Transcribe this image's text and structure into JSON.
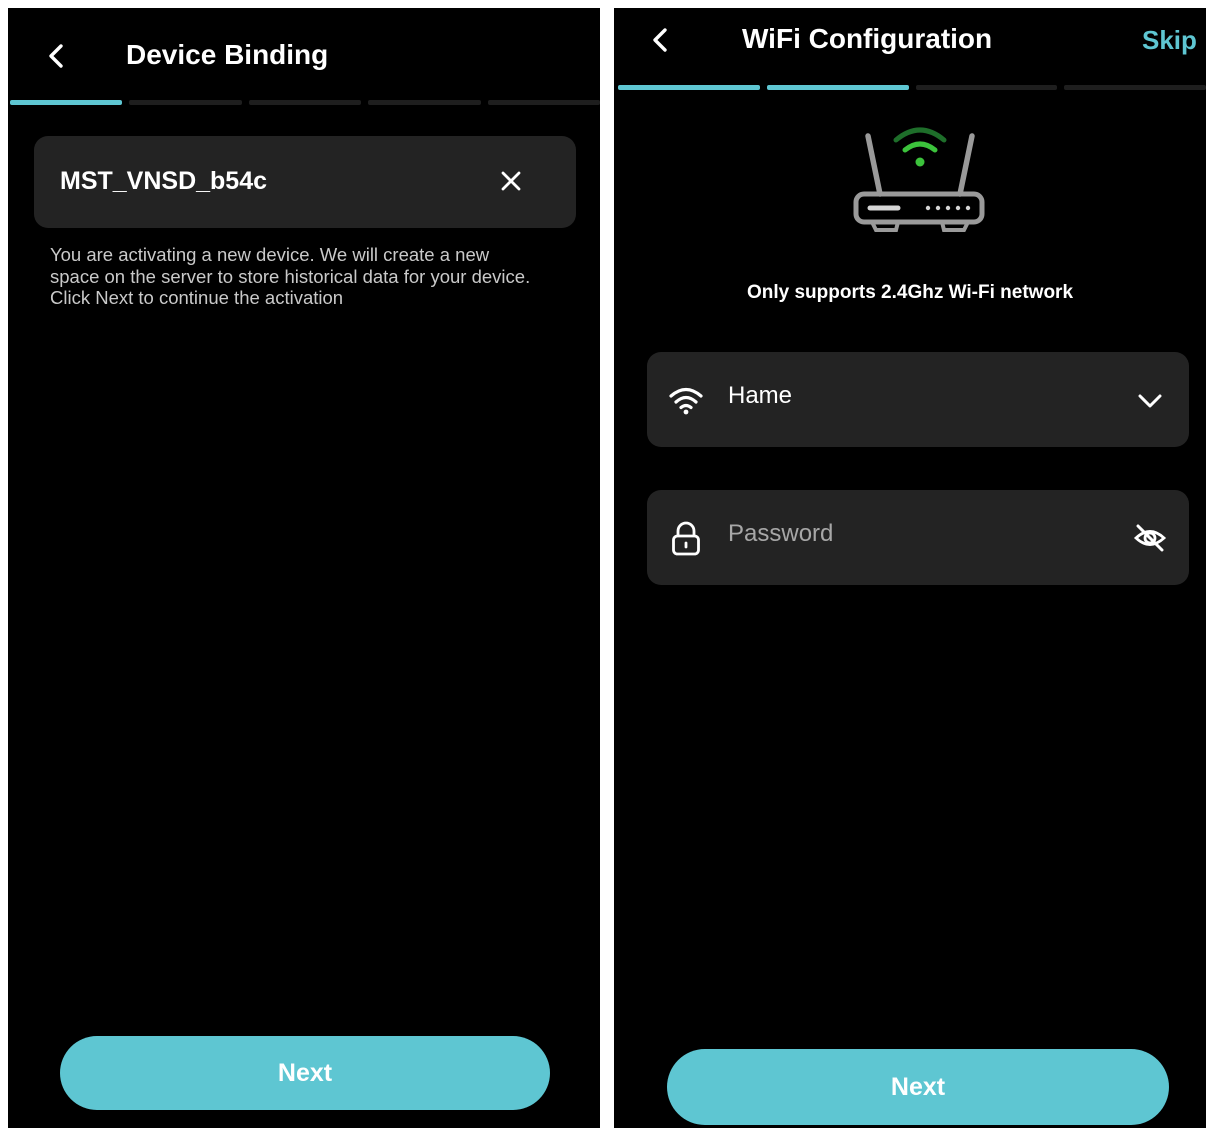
{
  "screens": [
    {
      "title": "Device Binding",
      "device_name": "MST_VNSD_b54c",
      "description": "You are activating a new device. We will create a new space on the server to store historical data for your device. Click Next to continue the activation",
      "progress": {
        "total": 5,
        "completed": 1
      },
      "next_label": "Next",
      "icons": {
        "back": "chevron-left-icon",
        "clear": "close-icon"
      }
    },
    {
      "title": "WiFi Configuration",
      "skip_label": "Skip",
      "notice": "Only supports 2.4Ghz Wi-Fi network",
      "wifi_name": "Hame",
      "password_placeholder": "Password",
      "progress": {
        "total": 4,
        "completed": 2
      },
      "next_label": "Next",
      "icons": {
        "back": "chevron-left-icon",
        "router": "router-icon",
        "wifi": "wifi-icon",
        "dropdown": "chevron-down-icon",
        "lock": "lock-icon",
        "visibility": "eye-off-icon"
      }
    }
  ],
  "colors": {
    "accent": "#5ec6d2",
    "wifi_signal": "#3cc33c",
    "background": "#000000",
    "card": "#232323"
  }
}
